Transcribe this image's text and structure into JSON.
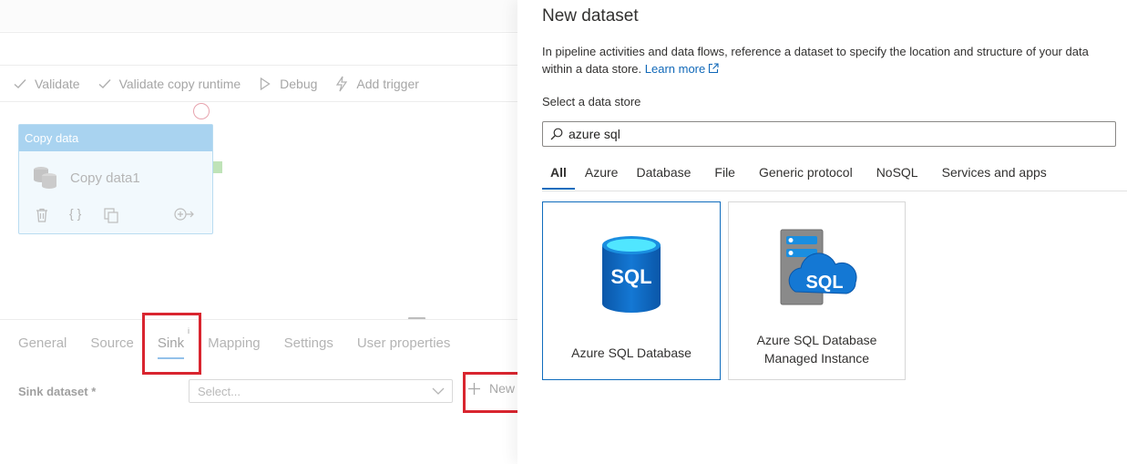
{
  "pipeline": {
    "toolbar": {
      "validate": "Validate",
      "validate_copy_runtime": "Validate copy runtime",
      "debug": "Debug",
      "add_trigger": "Add trigger"
    },
    "activity": {
      "type_label": "Copy data",
      "name": "Copy data1"
    },
    "properties": {
      "tabs": [
        "General",
        "Source",
        "Sink",
        "Mapping",
        "Settings",
        "User properties"
      ],
      "active_tab": "Sink",
      "sink_tab_info": "i",
      "sink_dataset_label": "Sink dataset *",
      "sink_dataset_placeholder": "Select...",
      "new_label": "New"
    }
  },
  "panel": {
    "title": "New dataset",
    "description": "In pipeline activities and data flows, reference a dataset to specify the location and structure of your data within a data store.",
    "learn_more": "Learn more",
    "store_label": "Select a data store",
    "search_value": "azure sql",
    "category_tabs": [
      "All",
      "Azure",
      "Database",
      "File",
      "Generic protocol",
      "NoSQL",
      "Services and apps"
    ],
    "selected_category": "All",
    "cards": [
      {
        "label": "Azure SQL Database",
        "icon": "azure-sql-database-icon",
        "icon_text": "SQL",
        "selected": true
      },
      {
        "label": "Azure SQL Database Managed Instance",
        "icon": "azure-sql-managed-instance-icon",
        "icon_text": "SQL",
        "selected": false
      }
    ]
  },
  "colors": {
    "accent": "#0f6cbd",
    "link": "#1068b8",
    "highlight": "#d9252f"
  }
}
